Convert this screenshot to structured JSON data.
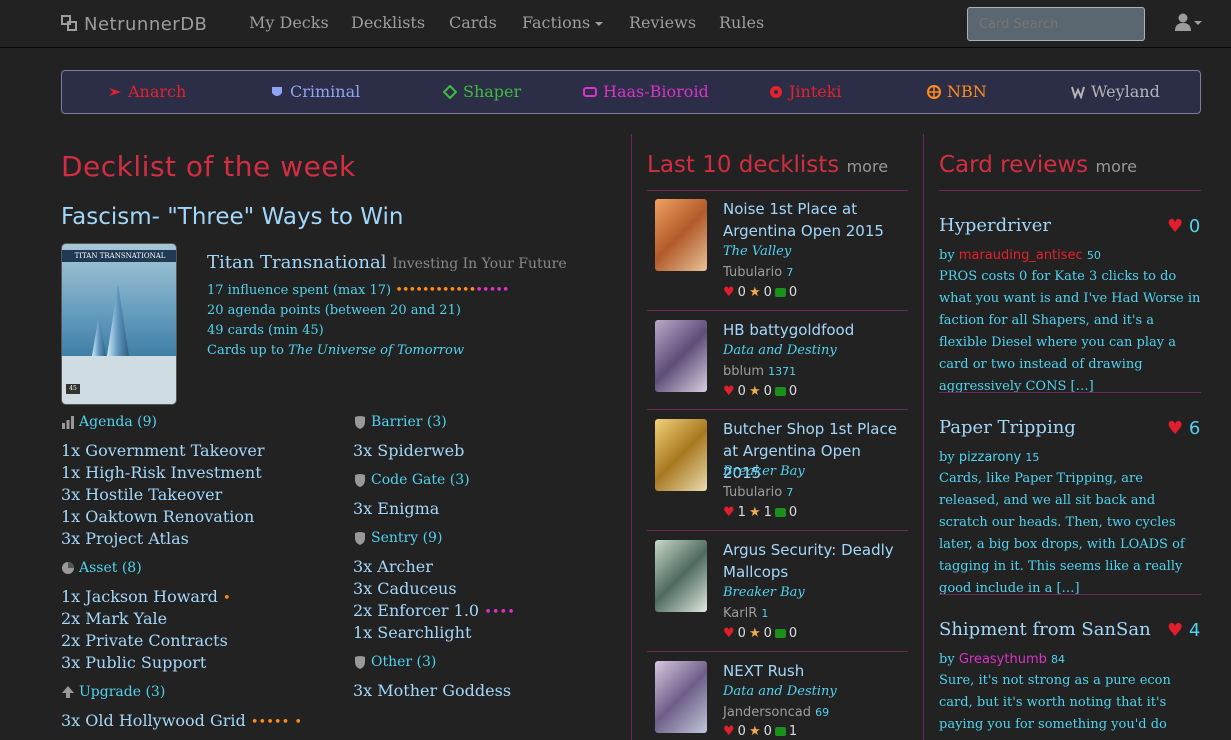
{
  "nav": {
    "brand": "NetrunnerDB",
    "items": [
      "My Decks",
      "Decklists",
      "Cards",
      "Factions",
      "Reviews",
      "Rules"
    ],
    "search_placeholder": "Card Search"
  },
  "factions": [
    {
      "name": "Anarch",
      "color": "#e5212e",
      "icon": "anarch-icon"
    },
    {
      "name": "Criminal",
      "color": "#8ea4f3",
      "icon": "criminal-icon"
    },
    {
      "name": "Shaper",
      "color": "#3fbc3f",
      "icon": "shaper-icon"
    },
    {
      "name": "Haas-Bioroid",
      "color": "#d933c7",
      "icon": "haas-bioroid-icon"
    },
    {
      "name": "Jinteki",
      "color": "#e5212e",
      "icon": "jinteki-icon"
    },
    {
      "name": "NBN",
      "color": "#ff8c1a",
      "icon": "nbn-icon"
    },
    {
      "name": "Weyland",
      "color": "#b5b5b5",
      "icon": "weyland-icon"
    }
  ],
  "dotw": {
    "heading": "Decklist of the week",
    "title": "Fascism- \"Three\" Ways to Win",
    "card_image_title": "TITAN TRANSNATIONAL",
    "identity": "Titan Transnational",
    "identity_sub": "Investing In Your Future",
    "influence": "17 influence spent (max 17)",
    "influence_dots": "•••••••••••••••••",
    "agenda_points": "20 agenda points (between 20 and 21)",
    "cards": "49 cards (min 45)",
    "cards_up_to_prefix": "Cards up to",
    "cards_up_to": "The Universe of Tomorrow",
    "groups_left": [
      {
        "label": "Agenda (9)",
        "icon": "agenda-icon",
        "lines": [
          "1x Government Takeover",
          "1x High-Risk Investment",
          "3x Hostile Takeover",
          "1x Oaktown Renovation",
          "3x Project Atlas"
        ]
      },
      {
        "label": "Asset (8)",
        "icon": "asset-icon",
        "lines": [
          "1x Jackson Howard",
          "2x Mark Yale",
          "2x Private Contracts",
          "3x Public Support"
        ]
      },
      {
        "label": "Upgrade (3)",
        "icon": "upgrade-icon",
        "lines": [
          "3x Old Hollywood Grid"
        ]
      }
    ],
    "groups_right": [
      {
        "label": "Barrier (3)",
        "icon": "barrier-icon",
        "lines": [
          "3x Spiderweb"
        ]
      },
      {
        "label": "Code Gate (3)",
        "icon": "code-gate-icon",
        "lines": [
          "3x Enigma"
        ]
      },
      {
        "label": "Sentry (9)",
        "icon": "sentry-icon",
        "lines": [
          "3x Archer",
          "3x Caduceus",
          "2x Enforcer 1.0",
          "1x Searchlight"
        ]
      },
      {
        "label": "Other (3)",
        "icon": "other-icon",
        "lines": [
          "3x Mother Goddess"
        ]
      }
    ],
    "inf_jackson": "•",
    "inf_enforcer": "••••",
    "inf_oldhollywood_a": "•••••",
    "inf_oldhollywood_b": "•"
  },
  "last": {
    "heading": "Last 10 decklists",
    "more": "more",
    "items": [
      {
        "name": "Noise 1st Place at Argentina Open 2015",
        "identity": "The Valley",
        "user": "Tubulario",
        "rep": "7",
        "likes": "0",
        "favs": "0",
        "comments": "0"
      },
      {
        "name": "HB battygoldfood",
        "identity": "Data and Destiny",
        "user": "bblum",
        "rep": "1371",
        "likes": "0",
        "favs": "0",
        "comments": "0"
      },
      {
        "name": "Butcher Shop 1st Place at Argentina Open 2015",
        "identity": "Breaker Bay",
        "user": "Tubulario",
        "rep": "7",
        "likes": "1",
        "favs": "1",
        "comments": "0"
      },
      {
        "name": "Argus Security: Deadly Mallcops",
        "identity": "Breaker Bay",
        "user": "KarlR",
        "rep": "1",
        "likes": "0",
        "favs": "0",
        "comments": "0"
      },
      {
        "name": "NEXT Rush",
        "identity": "Data and Destiny",
        "user": "Jandersoncad",
        "rep": "69",
        "likes": "0",
        "favs": "0",
        "comments": "1"
      }
    ]
  },
  "reviews": {
    "heading": "Card reviews",
    "more": "more",
    "by": "by",
    "items": [
      {
        "card": "Hyperdriver",
        "likes": "0",
        "user": "marauding_antisec",
        "user_color": "#e5212e",
        "rep": "50",
        "text": "PROS costs 0 for Kate 3 clicks to do what you want is and I've Had Worse in faction for all Shapers, and it's a flexible Diesel where you can play a card or two instead of drawing aggressively CONS […]"
      },
      {
        "card": "Paper Tripping",
        "likes": "6",
        "user": "pizzarony",
        "user_color": "#4fd3ef",
        "rep": "15",
        "text": "Cards, like Paper Tripping, are released, and we all sit back and scratch our heads. Then, two cycles later, a big box drops, with LOADS of tagging in it. This seems like a really good include in a […]"
      },
      {
        "card": "Shipment from SanSan",
        "likes": "4",
        "user": "Greasythumb",
        "user_color": "#d933c7",
        "rep": "84",
        "text": "Sure, it's not strong as a pure econ card, but it's worth noting that it's paying you for something you'd do anyway, so"
      }
    ]
  }
}
